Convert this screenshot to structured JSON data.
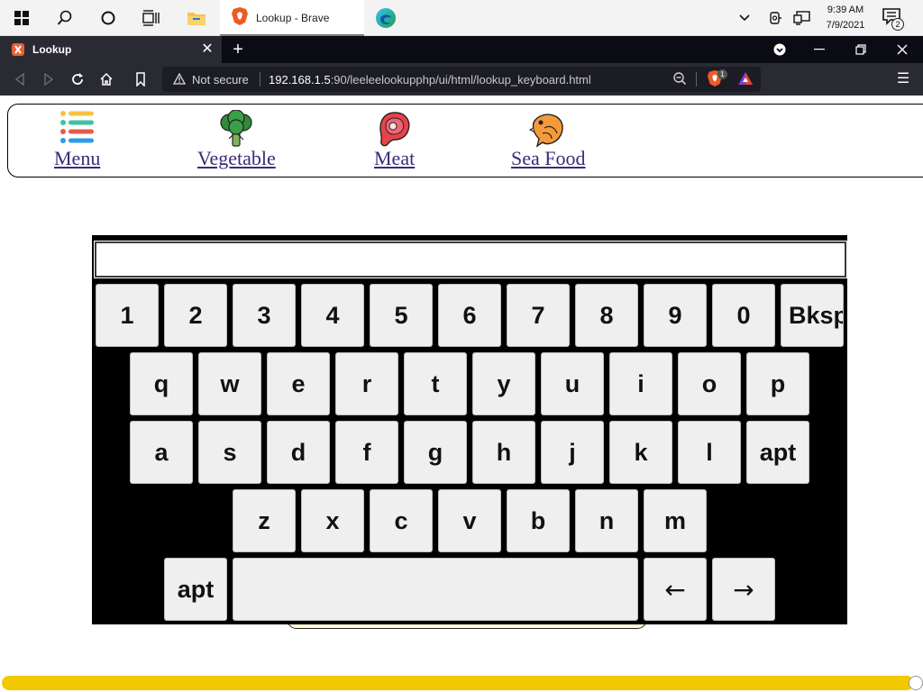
{
  "taskbar": {
    "app_title": "Lookup - Brave",
    "clock_time": "9:39 AM",
    "clock_date": "7/9/2021",
    "notification_count": "2",
    "icons": [
      "windows-start-icon",
      "search-icon",
      "cortana-icon",
      "task-view-icon",
      "file-explorer-icon",
      "brave-icon",
      "edge-icon",
      "chevron-up-icon",
      "camera-icon",
      "network-icon",
      "notification-icon"
    ]
  },
  "browser": {
    "tab_title": "Lookup",
    "close_glyph": "✕",
    "new_tab_glyph": "+",
    "not_secure": "Not secure",
    "url_host": "192.168.1.5",
    "url_rest": ":90/leeleelookupphp/ui/html/lookup_keyboard.html",
    "shield_count": "1",
    "menu_glyph": "☰"
  },
  "page": {
    "menu": [
      {
        "label": "Menu",
        "icon": "menu-list-icon"
      },
      {
        "label": "Vegetable",
        "icon": "broccoli-icon"
      },
      {
        "label": "Meat",
        "icon": "steak-icon"
      },
      {
        "label": "Sea Food",
        "icon": "fish-icon"
      }
    ],
    "keyboard": {
      "input_value": "",
      "row1": [
        "1",
        "2",
        "3",
        "4",
        "5",
        "6",
        "7",
        "8",
        "9",
        "0",
        "Bksp"
      ],
      "row2": [
        "q",
        "w",
        "e",
        "r",
        "t",
        "y",
        "u",
        "i",
        "o",
        "p"
      ],
      "row3": [
        "a",
        "s",
        "d",
        "f",
        "g",
        "h",
        "j",
        "k",
        "l",
        "apt"
      ],
      "row4": [
        "z",
        "x",
        "c",
        "v",
        "b",
        "n",
        "m"
      ],
      "row5": {
        "left": "apt",
        "space": "",
        "arrow_left": "←",
        "arrow_right": "→"
      }
    }
  },
  "colors": {
    "taskbar": "#f3f3f3",
    "tabbar": "#0b0b14",
    "navbar": "#2a2a33",
    "keyboard_bg": "#000000",
    "key_bg": "#efefef",
    "link": "#3b2a7a",
    "scrollbar": "#f2c900"
  }
}
